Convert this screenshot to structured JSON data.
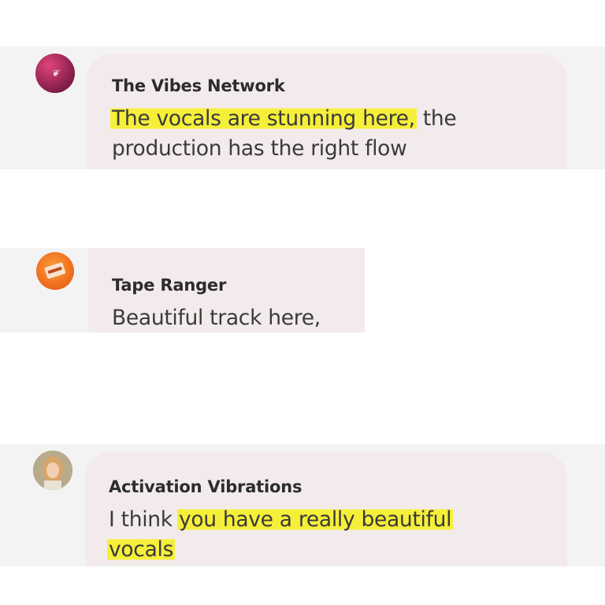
{
  "comments": [
    {
      "author": "The Vibes Network",
      "avatar_icon": "vibes-logo-icon",
      "message_lines": [
        {
          "highlight": "The vocals are stunning here,",
          "plain": " the"
        },
        {
          "highlight": "",
          "plain": "production has the right flow"
        }
      ]
    },
    {
      "author": "Tape Ranger",
      "avatar_icon": "cassette-tape-icon",
      "message_lines": [
        {
          "highlight": "",
          "plain": "Beautiful track here,"
        }
      ]
    },
    {
      "author": "Activation Vibrations",
      "avatar_icon": "user-photo-icon",
      "message_lines": [
        {
          "plain_before": "I think ",
          "highlight": "you have a really beautiful",
          "plain": ""
        },
        {
          "highlight": "vocals",
          "plain": ""
        }
      ]
    }
  ],
  "colors": {
    "highlight": "#f5ef3a",
    "bubble": "#f3ebeb",
    "strip": "#f3f3f4",
    "text": "#3a3a3a"
  }
}
